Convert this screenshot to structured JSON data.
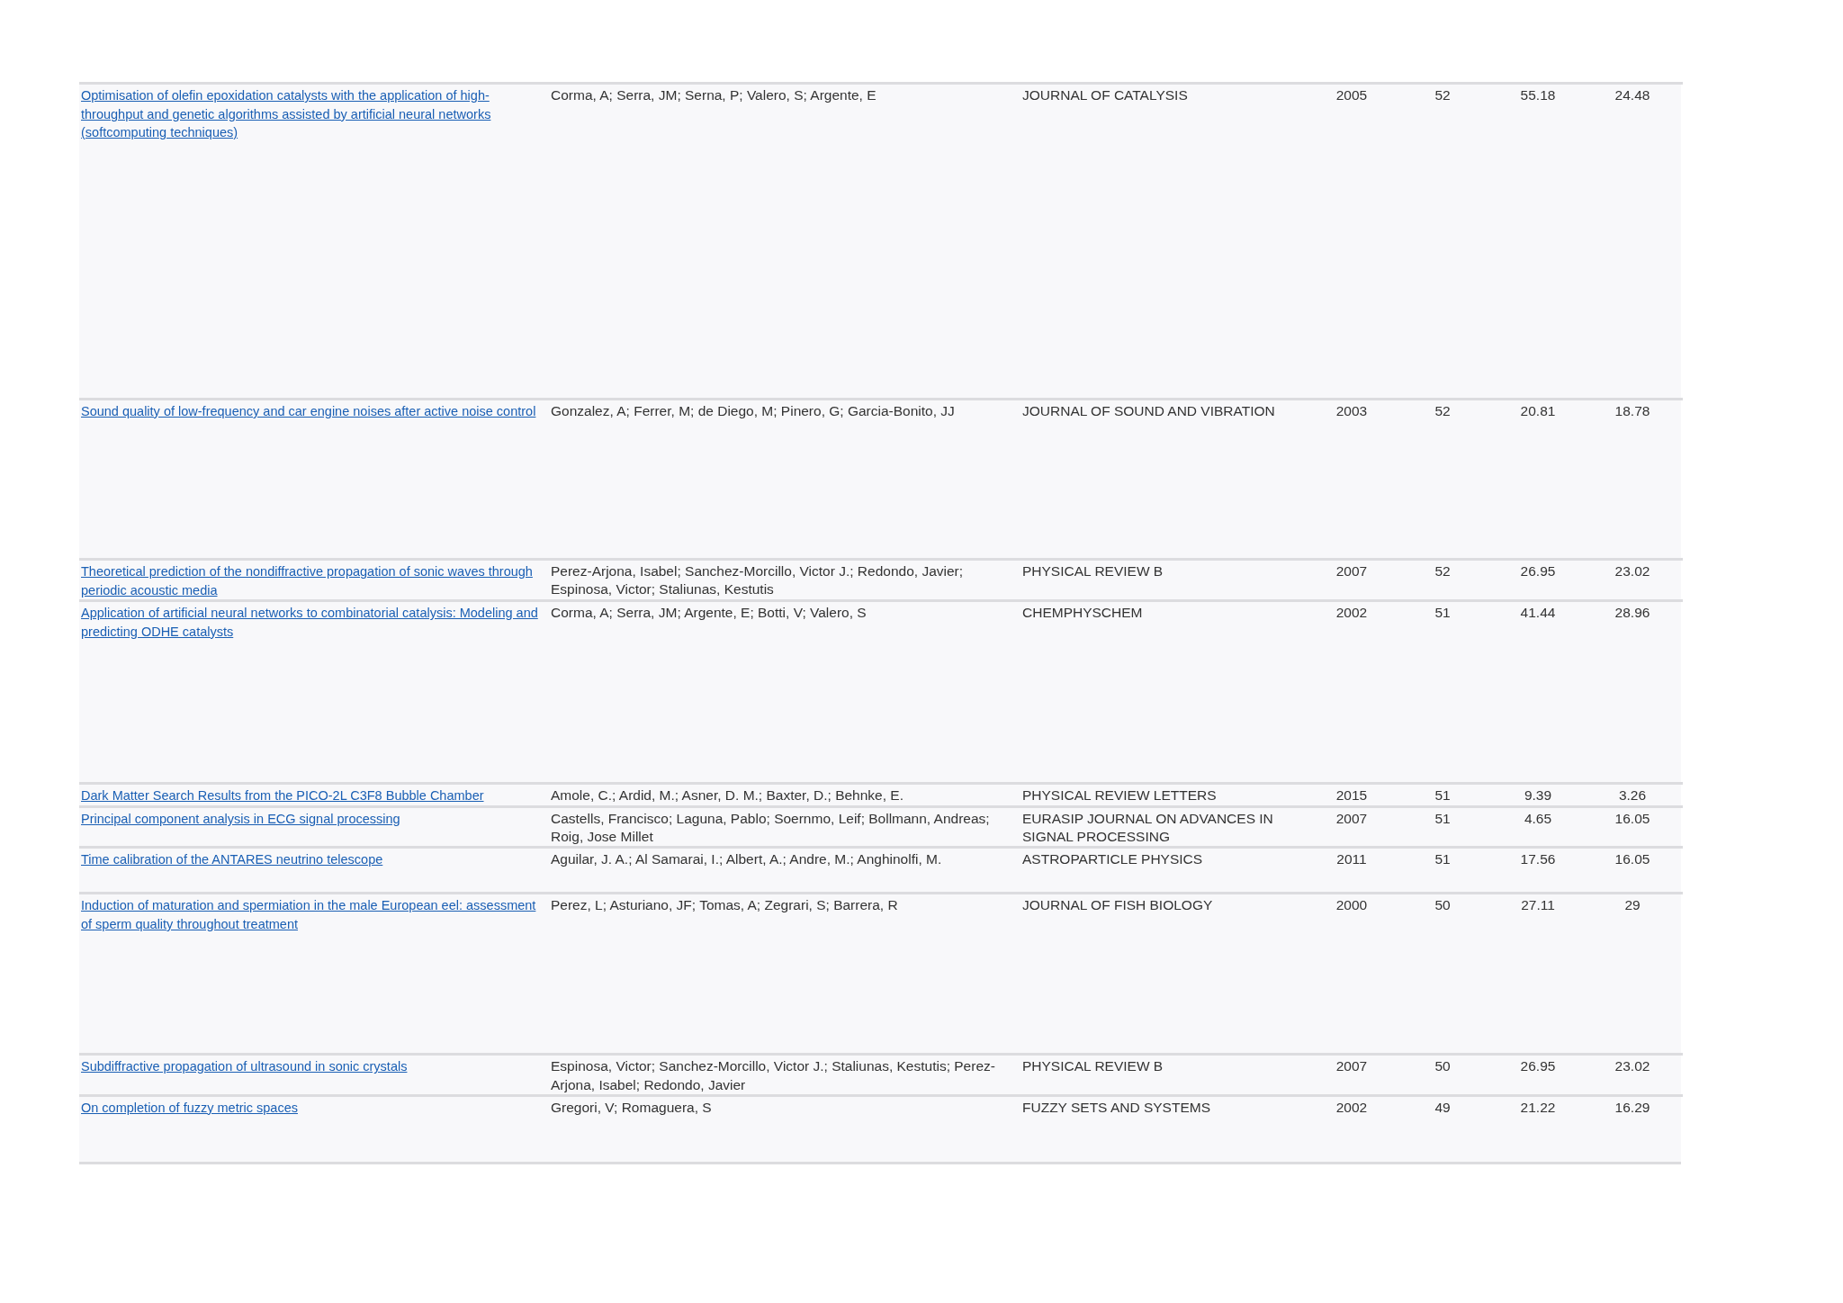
{
  "table": {
    "rows": [
      {
        "title": "Optimisation of olefin epoxidation catalysts with the application of high-throughput and genetic algorithms assisted by artificial neural networks (softcomputing techniques)",
        "authors": "Corma, A; Serra, JM; Serna, P; Valero, S; Argente, E",
        "journal": "JOURNAL OF CATALYSIS",
        "year": "2005",
        "column_5": "52",
        "column_6": "55.18",
        "column_7": "24.48"
      },
      {
        "title": "Sound quality of low-frequency and car engine noises after active noise control",
        "authors": "Gonzalez, A; Ferrer, M; de Diego, M; Pinero, G; Garcia-Bonito, JJ",
        "journal": "JOURNAL OF SOUND AND VIBRATION",
        "year": "2003",
        "column_5": "52",
        "column_6": "20.81",
        "column_7": "18.78"
      },
      {
        "title": "Theoretical prediction of the nondiffractive propagation of sonic waves through periodic acoustic media",
        "authors": "Perez-Arjona, Isabel; Sanchez-Morcillo, Victor J.; Redondo, Javier; Espinosa, Victor; Staliunas, Kestutis",
        "journal": "PHYSICAL REVIEW B",
        "year": "2007",
        "column_5": "52",
        "column_6": "26.95",
        "column_7": "23.02"
      },
      {
        "title": "Application of artificial neural networks to combinatorial catalysis: Modeling and predicting ODHE catalysts",
        "authors": "Corma, A; Serra, JM; Argente, E; Botti, V; Valero, S",
        "journal": "CHEMPHYSCHEM",
        "year": "2002",
        "column_5": "51",
        "column_6": "41.44",
        "column_7": "28.96"
      },
      {
        "title": "Dark Matter Search Results from the PICO-2L C3F8 Bubble Chamber",
        "authors": "Amole, C.; Ardid, M.; Asner, D. M.; Baxter, D.; Behnke, E.",
        "journal": "PHYSICAL REVIEW LETTERS",
        "year": "2015",
        "column_5": "51",
        "column_6": "9.39",
        "column_7": "3.26"
      },
      {
        "title": "Principal component analysis in ECG signal processing",
        "authors": "Castells, Francisco; Laguna, Pablo; Soernmo, Leif; Bollmann, Andreas; Roig, Jose Millet",
        "journal": "EURASIP JOURNAL ON ADVANCES IN SIGNAL PROCESSING",
        "year": "2007",
        "column_5": "51",
        "column_6": "4.65",
        "column_7": "16.05"
      },
      {
        "title": "Time calibration of the ANTARES neutrino telescope",
        "authors": "Aguilar, J. A.; Al Samarai, I.; Albert, A.; Andre, M.; Anghinolfi, M.",
        "journal": "ASTROPARTICLE PHYSICS",
        "year": "2011",
        "column_5": "51",
        "column_6": "17.56",
        "column_7": "16.05"
      },
      {
        "title": "Induction of maturation and spermiation in the male European eel: assessment of sperm quality throughout treatment",
        "authors": "Perez, L; Asturiano, JF; Tomas, A; Zegrari, S; Barrera, R",
        "journal": "JOURNAL OF FISH BIOLOGY",
        "year": "2000",
        "column_5": "50",
        "column_6": "27.11",
        "column_7": "29"
      },
      {
        "title": "Subdiffractive propagation of ultrasound in sonic crystals",
        "authors": "Espinosa, Victor; Sanchez-Morcillo, Victor J.; Staliunas, Kestutis; Perez-Arjona, Isabel; Redondo, Javier",
        "journal": "PHYSICAL REVIEW B",
        "year": "2007",
        "column_5": "50",
        "column_6": "26.95",
        "column_7": "23.02"
      },
      {
        "title": "On completion of fuzzy metric spaces",
        "authors": "Gregori, V; Romaguera, S",
        "journal": "FUZZY SETS AND SYSTEMS",
        "year": "2002",
        "column_5": "49",
        "column_6": "21.22",
        "column_7": "16.29"
      }
    ]
  }
}
